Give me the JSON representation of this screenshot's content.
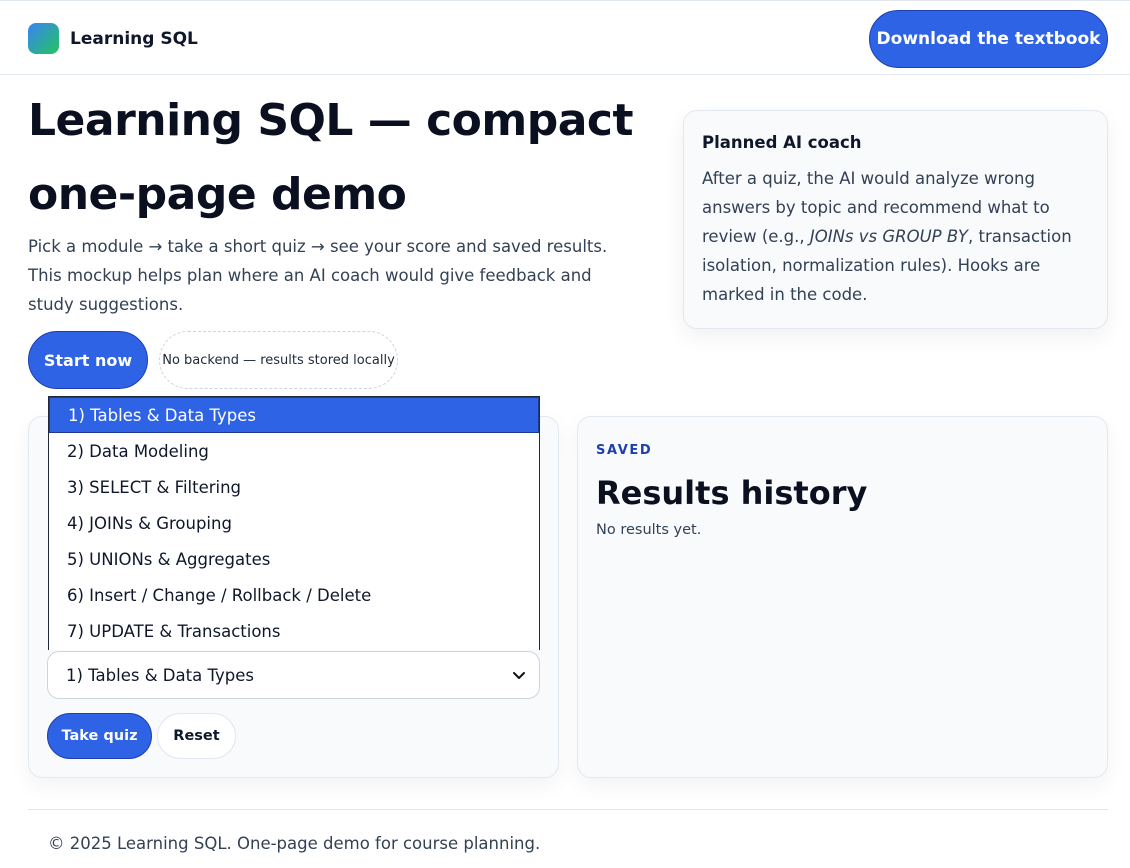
{
  "header": {
    "brand_name": "Learning SQL",
    "download_label": "Download the textbook"
  },
  "hero": {
    "title_line1": "Learning SQL — compact",
    "title_line2": "one-page demo",
    "description": "Pick a module → take a short quiz → see your score and saved results. This mockup helps plan where an AI coach would give feedback and study suggestions.",
    "start_label": "Start now",
    "note": "No backend — results stored locally"
  },
  "coach": {
    "title": "Planned AI coach",
    "text_before": "After a quiz, the AI would analyze wrong answers by topic and recommend what to review (e.g., ",
    "text_emphasis": "JOINs vs GROUP BY",
    "text_after": ", transaction isolation, normalization rules). Hooks are marked in the code."
  },
  "quiz": {
    "options": [
      "1) Tables & Data Types",
      "2) Data Modeling",
      "3) SELECT & Filtering",
      "4) JOINs & Grouping",
      "5) UNIONs & Aggregates",
      "6) Insert / Change / Rollback / Delete",
      "7) UPDATE & Transactions"
    ],
    "selected": "1) Tables & Data Types",
    "take_label": "Take quiz",
    "reset_label": "Reset"
  },
  "results": {
    "eyebrow": "SAVED",
    "title": "Results history",
    "empty_text": "No results yet."
  },
  "footer": {
    "text": "© 2025 Learning SQL. One-page demo for course planning."
  },
  "colors": {
    "accent": "#2f63e6",
    "eyebrow": "#1e40af"
  }
}
